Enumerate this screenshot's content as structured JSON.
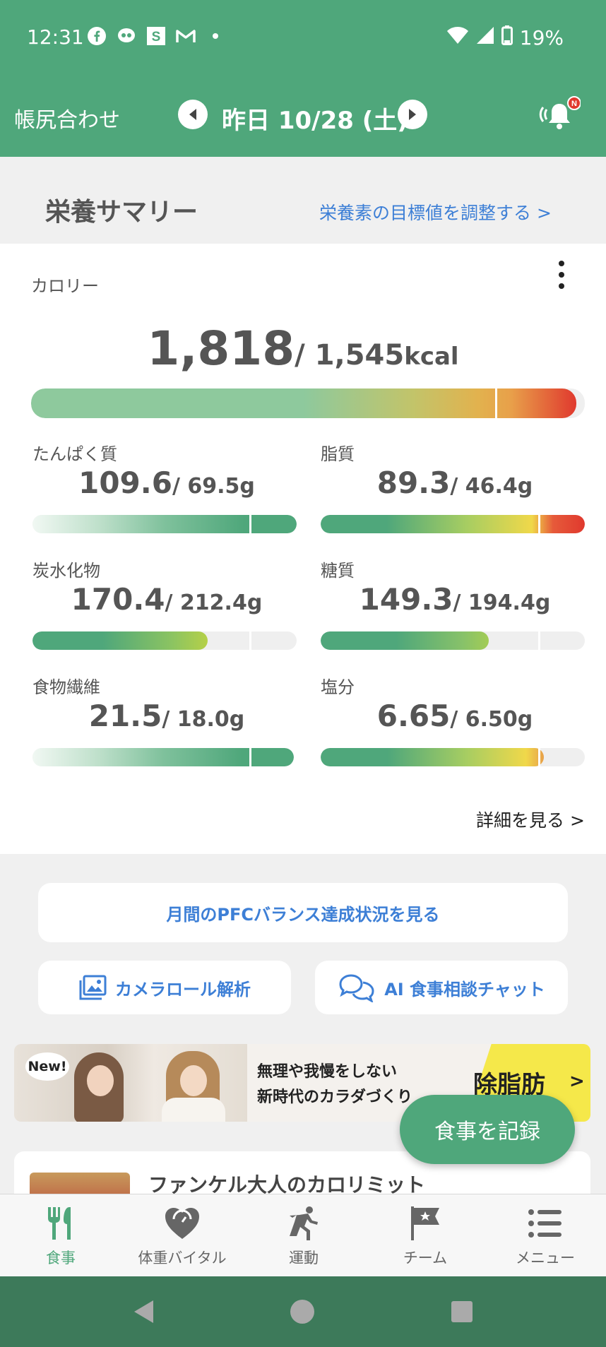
{
  "status_bar": {
    "time": "12:31",
    "app_icons": [
      "facebook-icon",
      "mixi-icon",
      "s-app-icon",
      "gmail-icon",
      "dot-icon"
    ],
    "battery": "19%"
  },
  "app_bar": {
    "title": "帳尻合わせ",
    "date": "昨日 10/28 (土)",
    "notification_badge": "N"
  },
  "summary": {
    "title": "栄養サマリー",
    "adjust_link": "栄養素の目標値を調整する >"
  },
  "calorie": {
    "label": "カロリー",
    "value": "1,818",
    "target": "/ 1,545",
    "unit": "kcal",
    "ratio": 1.177
  },
  "nutrients": [
    {
      "label": "たんぱく質",
      "value": "109.6",
      "target": "/ 69.5g",
      "ratio": 1.577
    },
    {
      "label": "脂質",
      "value": "89.3",
      "target": "/ 46.4g",
      "ratio": 1.925
    },
    {
      "label": "炭水化物",
      "value": "170.4",
      "target": "/ 212.4g",
      "ratio": 0.802
    },
    {
      "label": "糖質",
      "value": "149.3",
      "target": "/ 194.4g",
      "ratio": 0.768
    },
    {
      "label": "食物繊維",
      "value": "21.5",
      "target": "/ 18.0g",
      "ratio": 1.194
    },
    {
      "label": "塩分",
      "value": "6.65",
      "target": "/ 6.50g",
      "ratio": 1.023
    }
  ],
  "detail_link": "詳細を見る >",
  "buttons": {
    "pfc": "月間のPFCバランス達成状況を見る",
    "camera_roll": "カメラロール解析",
    "ai_chat": "AI 食事相談チャット"
  },
  "banner": {
    "badge": "New!",
    "line1": "無理や我慢をしない",
    "line2": "新時代のカラダづくり",
    "highlight": "除脂肪",
    "arrow": ">"
  },
  "product": {
    "title": "ファンケル大人のカロリミット"
  },
  "fab": {
    "label": "食事を記録"
  },
  "bottom_nav": [
    {
      "label": "食事",
      "icon": "fork-knife-icon",
      "active": true
    },
    {
      "label": "体重バイタル",
      "icon": "heart-scale-icon",
      "active": false
    },
    {
      "label": "運動",
      "icon": "running-icon",
      "active": false
    },
    {
      "label": "チーム",
      "icon": "flag-star-icon",
      "active": false
    },
    {
      "label": "メニュー",
      "icon": "menu-list-icon",
      "active": false
    }
  ],
  "colors": {
    "brand_green": "#4fa77b",
    "link_blue": "#3d7fd6",
    "over_red": "#e0392e",
    "warn_yellow": "#f0d84a"
  }
}
